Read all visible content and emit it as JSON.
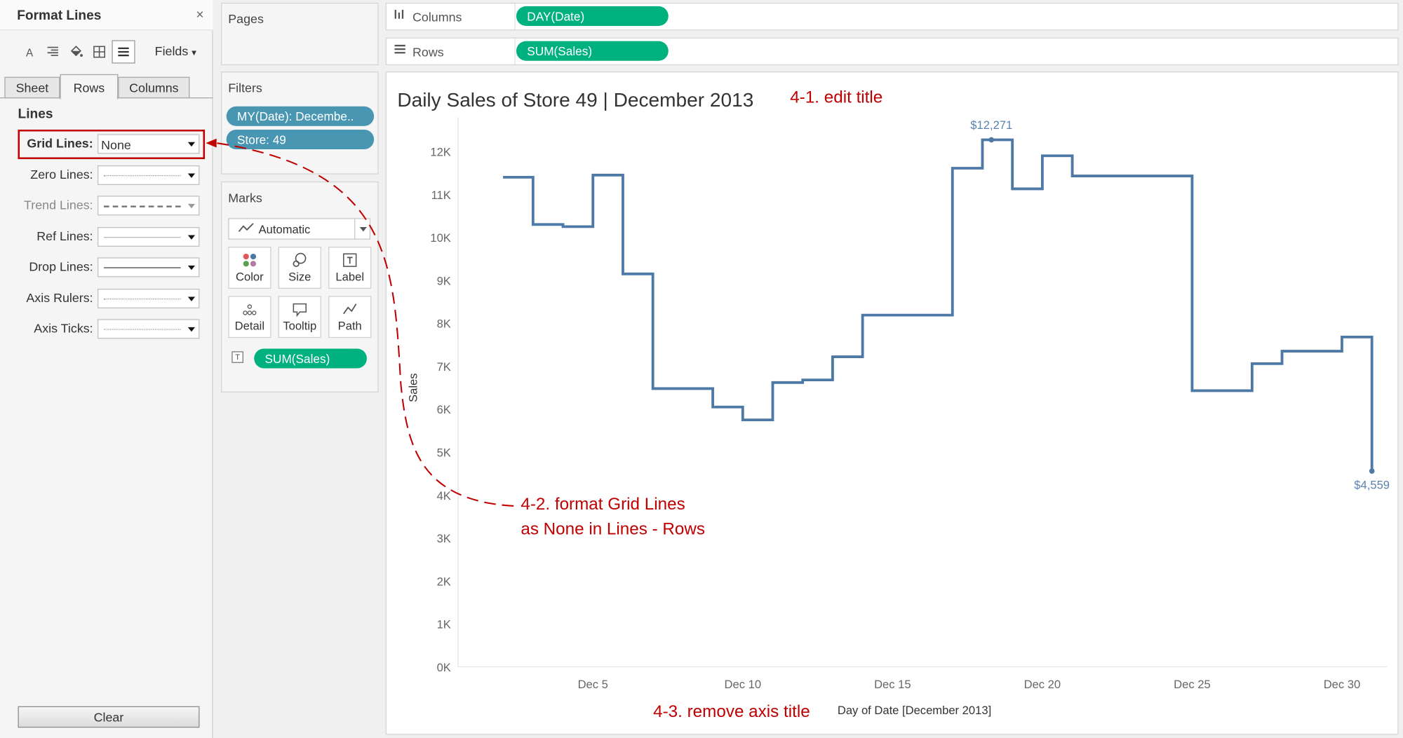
{
  "format_panel": {
    "title": "Format Lines",
    "close_glyph": "×",
    "toolbar": {
      "icons": [
        "font-icon",
        "align-icon",
        "shading-icon",
        "borders-icon",
        "lines-icon"
      ],
      "fields_label": "Fields"
    },
    "tabs": [
      {
        "label": "Sheet",
        "active": false
      },
      {
        "label": "Rows",
        "active": true
      },
      {
        "label": "Columns",
        "active": false
      }
    ],
    "section_title": "Lines",
    "options": [
      {
        "label": "Grid Lines:",
        "value": "None",
        "style": "text",
        "highlighted": true
      },
      {
        "label": "Zero Lines:",
        "value": "",
        "style": "dotted"
      },
      {
        "label": "Trend Lines:",
        "value": "",
        "style": "dashed",
        "disabled": true
      },
      {
        "label": "Ref Lines:",
        "value": "",
        "style": "thin"
      },
      {
        "label": "Drop Lines:",
        "value": "",
        "style": "solid"
      },
      {
        "label": "Axis Rulers:",
        "value": "",
        "style": "dotted"
      },
      {
        "label": "Axis Ticks:",
        "value": "",
        "style": "dotted"
      }
    ],
    "clear_label": "Clear"
  },
  "pages_card": {
    "title": "Pages"
  },
  "filters_card": {
    "title": "Filters",
    "pills": [
      "MY(Date): Decembe..",
      "Store: 49"
    ]
  },
  "marks_card": {
    "title": "Marks",
    "mark_type": "Automatic",
    "buttons": [
      {
        "label": "Color",
        "icon": "color-icon"
      },
      {
        "label": "Size",
        "icon": "size-icon"
      },
      {
        "label": "Label",
        "icon": "label-icon"
      },
      {
        "label": "Detail",
        "icon": "detail-icon"
      },
      {
        "label": "Tooltip",
        "icon": "tooltip-icon"
      },
      {
        "label": "Path",
        "icon": "path-icon"
      }
    ],
    "label_pill": "SUM(Sales)"
  },
  "shelves": {
    "columns": {
      "label": "Columns",
      "pill": "DAY(Date)"
    },
    "rows": {
      "label": "Rows",
      "pill": "SUM(Sales)"
    }
  },
  "worksheet": {
    "title": "Daily Sales of Store 49 | December 2013"
  },
  "annotations": {
    "edit_title": "4-1. edit title",
    "grid_lines_1": "4-2. format Grid Lines",
    "grid_lines_2": "as None in Lines - Rows",
    "remove_axis": "4-3. remove axis title",
    "color": "#c00000"
  },
  "chart_data": {
    "type": "line",
    "step": true,
    "ylabel": "Sales",
    "xlabel": "Day of Date [December 2013]",
    "ylim": [
      0,
      12800
    ],
    "xlim": [
      0.5,
      31.5
    ],
    "y_ticks": [
      0,
      1000,
      2000,
      3000,
      4000,
      5000,
      6000,
      7000,
      8000,
      9000,
      10000,
      11000,
      12000
    ],
    "y_tick_labels": [
      "0K",
      "1K",
      "2K",
      "3K",
      "4K",
      "5K",
      "6K",
      "7K",
      "8K",
      "9K",
      "10K",
      "11K",
      "12K"
    ],
    "x_ticks": [
      5,
      10,
      15,
      20,
      25,
      30
    ],
    "x_tick_labels": [
      "Dec 5",
      "Dec 10",
      "Dec 15",
      "Dec 20",
      "Dec 25",
      "Dec 30"
    ],
    "grid": false,
    "color": "#4e79a7",
    "x": [
      2,
      3,
      4,
      5,
      6,
      7,
      8,
      9,
      10,
      11,
      12,
      13,
      14,
      15,
      16,
      17,
      18,
      19,
      20,
      21,
      22,
      23,
      24,
      25,
      26,
      27,
      28,
      29,
      30,
      31
    ],
    "values": [
      11400,
      10300,
      10250,
      11450,
      9150,
      6480,
      6480,
      6050,
      5750,
      6620,
      6680,
      7220,
      8190,
      8190,
      8190,
      11610,
      12271,
      11130,
      11900,
      11430,
      11430,
      11430,
      11430,
      6430,
      6430,
      7060,
      7350,
      7350,
      7680,
      4559
    ],
    "data_labels": [
      {
        "x": 18.3,
        "value": 12271,
        "text": "$12,271"
      },
      {
        "x": 31,
        "value": 4559,
        "text": "$4,559"
      }
    ]
  }
}
